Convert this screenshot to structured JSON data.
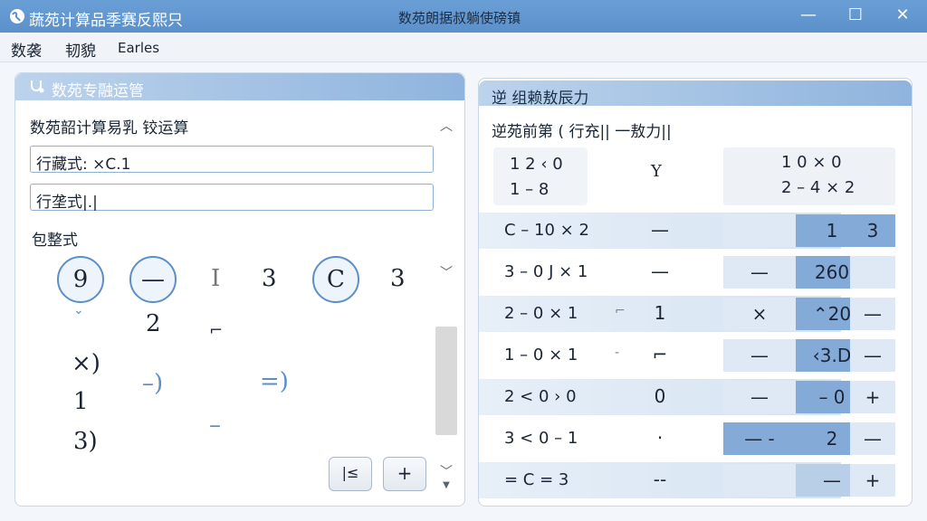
{
  "window": {
    "app_title": "蔬苑计算品季赛反熙只",
    "center_title": "数苑朗据叔躺使磅镇",
    "controls": {
      "minimize": "—",
      "maximize": "☐",
      "close": "✕"
    }
  },
  "menu": [
    "数袭",
    "韧貌",
    "Earles"
  ],
  "left_panel": {
    "header_title": "数苑专融运管",
    "section_label": "数苑韶计算易乳 铰运算",
    "input1": "行藏式: ×C.1",
    "input2": "行垄式|.|",
    "sub_label": "包整式",
    "tokens": {
      "c1": "9",
      "c2": "—",
      "t1": "I",
      "t2": "3",
      "c3": "C",
      "t3": "3",
      "t4": "2",
      "t5": "⌄",
      "t6": "×)",
      "t7": "1",
      "t8": "3)",
      "t9": "–)",
      "t10": "=)",
      "t11": "–",
      "t12": "⌐"
    },
    "buttons": {
      "left": "|≤",
      "right": "+"
    }
  },
  "right_panel": {
    "header_title": "逆  组赖敖辰力",
    "sub_label": "逆苑前第 ( 行充|| 一敖力||",
    "lcd_left": {
      "l1": "1 2   ‹ 0",
      "l2": "1 – 8"
    },
    "lcd_op": "Y",
    "lcd_right": {
      "l1": "1 0 × 0",
      "l2": "2 – 4 × 2"
    },
    "rows": [
      {
        "text": "C – 10 × 2",
        "mid": "",
        "op": "—",
        "cells": [
          "",
          "1",
          "3"
        ],
        "dark": [
          false,
          true,
          true
        ]
      },
      {
        "text": "3 – 0 J × 1",
        "mid": "",
        "op": "—",
        "cells": [
          "—",
          "260",
          ""
        ],
        "dark": [
          false,
          true,
          false
        ]
      },
      {
        "text": "2 – 0 × 1",
        "mid": "⌐",
        "op": "1",
        "cells": [
          "×",
          "⌃20",
          "—"
        ],
        "dark": [
          false,
          true,
          false
        ]
      },
      {
        "text": "1 – 0 × 1",
        "mid": "‑",
        "op": "⌐",
        "cells": [
          "—",
          "‹3.D",
          "—"
        ],
        "dark": [
          false,
          true,
          false
        ]
      },
      {
        "text": "2 < 0 › 0",
        "mid": "",
        "op": "0",
        "cells": [
          "—",
          "– 0",
          "+"
        ],
        "dark": [
          false,
          true,
          false
        ]
      },
      {
        "text": "3 < 0 – 1",
        "mid": "",
        "op": "·",
        "cells": [
          "—   -",
          "2",
          "—"
        ],
        "dark": [
          true,
          true,
          false
        ]
      },
      {
        "text": "=  C =  3",
        "mid": "",
        "op": "‑‑",
        "cells": [
          "",
          "—",
          "+"
        ],
        "dark": [
          false,
          false,
          false
        ]
      }
    ]
  },
  "colors": {
    "titlebar": "#5b90ca",
    "accent": "#84aad8"
  }
}
